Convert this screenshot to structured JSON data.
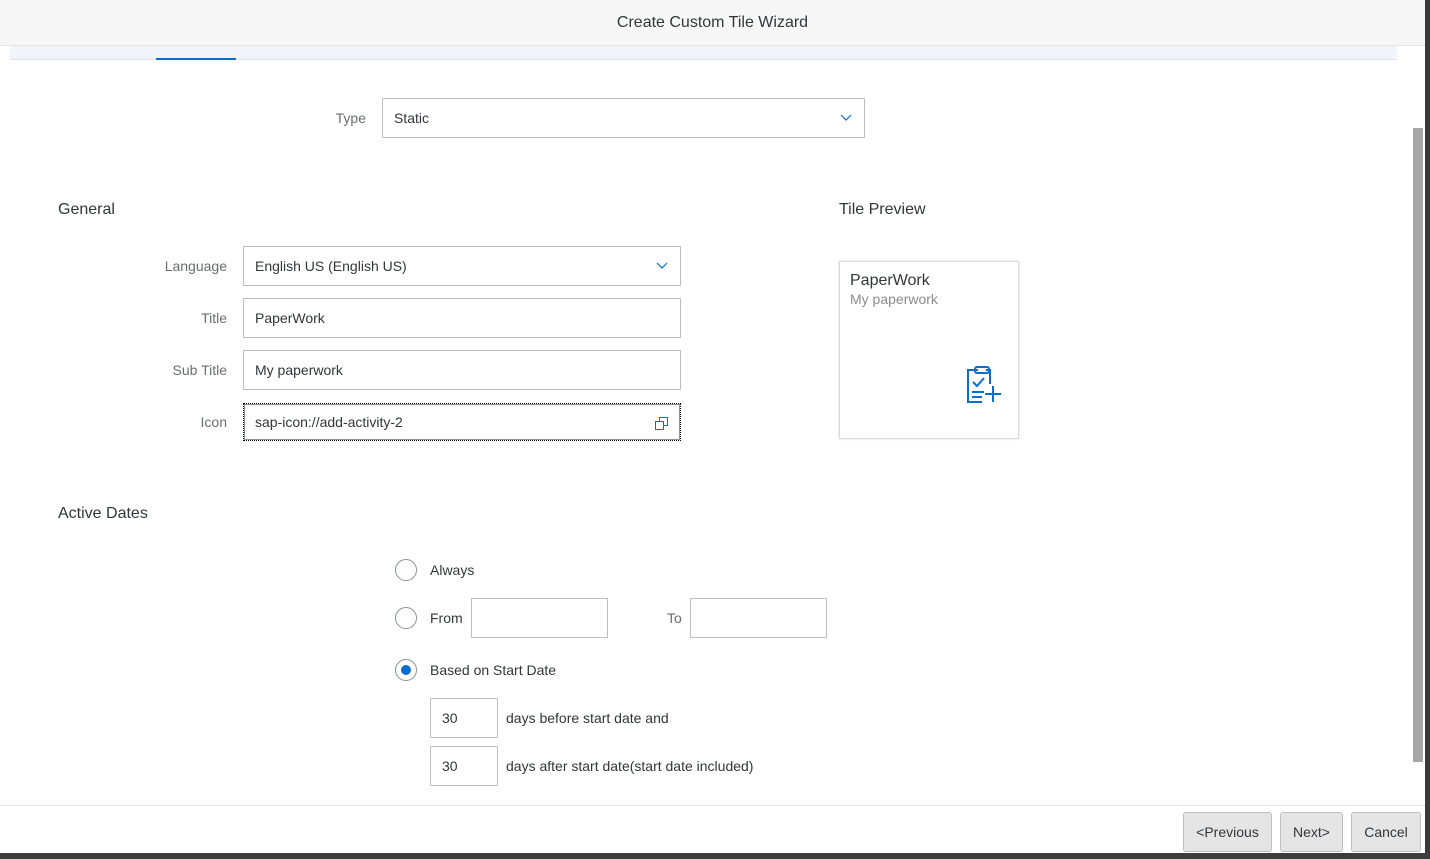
{
  "dialog": {
    "title": "Create Custom Tile Wizard"
  },
  "type_field": {
    "label": "Type",
    "value": "Static"
  },
  "general": {
    "title": "General",
    "language": {
      "label": "Language",
      "value": "English US (English US)"
    },
    "title_field": {
      "label": "Title",
      "value": "PaperWork"
    },
    "subtitle_field": {
      "label": "Sub Title",
      "value": "My paperwork"
    },
    "icon_field": {
      "label": "Icon",
      "value": "sap-icon://add-activity-2"
    }
  },
  "preview": {
    "title": "Tile Preview",
    "tile_title": "PaperWork",
    "tile_subtitle": "My paperwork",
    "tile_icon": "add-activity-icon",
    "accent_color": "#0a6ed1"
  },
  "active_dates": {
    "title": "Active Dates",
    "always_label": "Always",
    "from_label": "From",
    "to_label": "To",
    "from_value": "",
    "to_value": "",
    "based_label": "Based on Start Date",
    "selected": "based",
    "before_days": "30",
    "before_text": "days before start date and",
    "after_days": "30",
    "after_text": "days after start date(start date included)"
  },
  "footer": {
    "previous_label": "<Previous",
    "next_label": "Next>",
    "cancel_label": "Cancel"
  }
}
